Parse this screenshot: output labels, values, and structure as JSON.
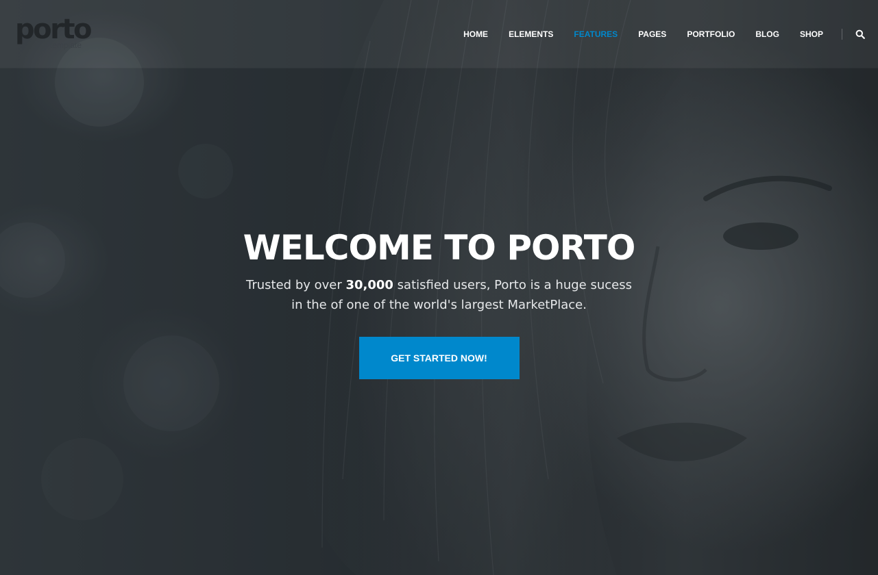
{
  "brand": {
    "logo_word": "porto",
    "logo_sub": "template"
  },
  "nav": {
    "items": [
      {
        "label": "HOME"
      },
      {
        "label": "ELEMENTS"
      },
      {
        "label": "FEATURES",
        "active": true
      },
      {
        "label": "PAGES"
      },
      {
        "label": "PORTFOLIO"
      },
      {
        "label": "BLOG"
      },
      {
        "label": "SHOP"
      }
    ],
    "search_icon": "search-icon"
  },
  "hero": {
    "title": "WELCOME TO PORTO",
    "sub_line1_pre": "Trusted by over ",
    "sub_line1_bold": "30,000",
    "sub_line1_post": " satisfied users, Porto is a huge sucess",
    "sub_line2": "in the of one of the world's largest MarketPlace.",
    "cta_label": "GET STARTED NOW!"
  },
  "colors": {
    "accent": "#0088cc",
    "nav_text": "#ffffff",
    "title": "#ffffff"
  }
}
